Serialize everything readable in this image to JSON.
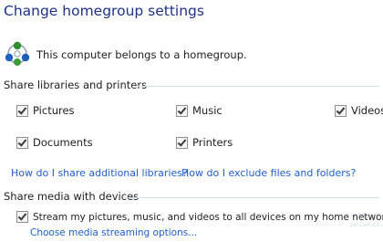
{
  "window": {
    "title": "Change homegroup settings"
  },
  "status": {
    "membership_text": "This computer belongs to a homegroup.",
    "icon": "homegroup-icon"
  },
  "share_libraries": {
    "title": "Share libraries and printers",
    "items": [
      {
        "label": "Pictures",
        "checked": true
      },
      {
        "label": "Music",
        "checked": true
      },
      {
        "label": "Videos",
        "checked": true
      },
      {
        "label": "Documents",
        "checked": true
      },
      {
        "label": "Printers",
        "checked": true
      }
    ],
    "links": {
      "share_more": "How do I share additional libraries?",
      "exclude": "How do I exclude files and folders?"
    }
  },
  "share_media": {
    "title": "Share media with devices",
    "stream_label": "Stream my pictures, music, and videos to all devices on my home network",
    "stream_checked": true,
    "options_link": "Choose media streaming options..."
  },
  "watermark": {
    "line1": "中关村在线",
    "line2": "zol.com.cn"
  },
  "colors": {
    "title": "#1e3287",
    "link": "#1f5fc9",
    "separator": "#d6dbe5"
  }
}
